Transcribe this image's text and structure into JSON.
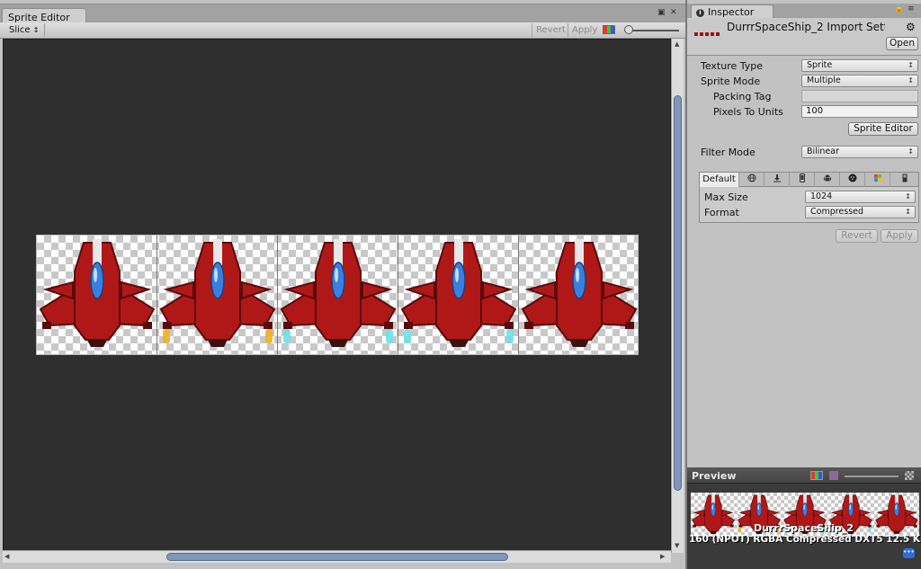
{
  "sprite_editor": {
    "tab_title": "Sprite Editor",
    "toolbar": {
      "slice_label": "Slice",
      "revert_label": "Revert",
      "apply_label": "Apply"
    },
    "frame_count": 5
  },
  "inspector": {
    "tab_title": "Inspector",
    "asset_title": "DurrrSpaceShip_2 Import Settings",
    "open_label": "Open",
    "texture_type": {
      "label": "Texture Type",
      "value": "Sprite"
    },
    "sprite_mode": {
      "label": "Sprite Mode",
      "value": "Multiple"
    },
    "packing_tag": {
      "label": "Packing Tag",
      "value": ""
    },
    "pixels_to_units": {
      "label": "Pixels To Units",
      "value": "100"
    },
    "sprite_editor_button": "Sprite Editor",
    "filter_mode": {
      "label": "Filter Mode",
      "value": "Bilinear"
    },
    "platforms": {
      "default_label": "Default",
      "icons": [
        "globe-icon",
        "download-icon",
        "phone-icon",
        "android-icon",
        "blackberry-icon",
        "windows-icon",
        "device-icon"
      ]
    },
    "max_size": {
      "label": "Max Size",
      "value": "1024"
    },
    "format": {
      "label": "Format",
      "value": "Compressed"
    },
    "revert_label": "Revert",
    "apply_label": "Apply"
  },
  "preview": {
    "title": "Preview",
    "asset_name": "DurrrSpaceShip_2",
    "info": "160 (NPOT)  RGBA Compressed DXT5   12.5 KB"
  },
  "colors": {
    "canvas_bg": "#2f2f2f",
    "ship_red": "#b01818",
    "ship_dark": "#5a0a0a",
    "cockpit_blue": "#3a7fe0",
    "scrollbar_thumb": "#7f97b8"
  }
}
